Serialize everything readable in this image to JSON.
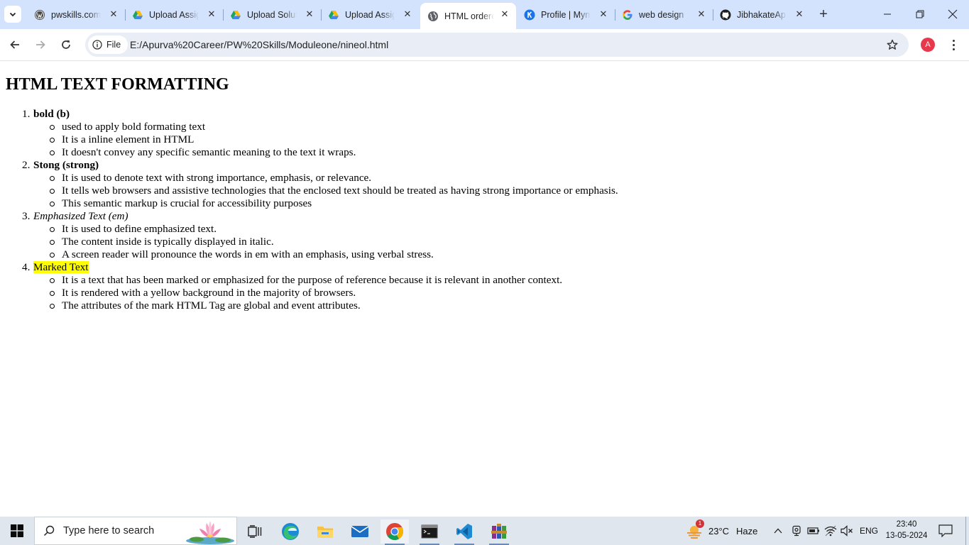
{
  "browser": {
    "tabs": [
      {
        "title": "pwskills.com",
        "icon": "wordpress-icon",
        "active": false
      },
      {
        "title": "Upload Assig",
        "icon": "google-drive-icon",
        "active": false
      },
      {
        "title": "Upload Solut",
        "icon": "google-drive-icon",
        "active": false
      },
      {
        "title": "Upload Assig",
        "icon": "google-drive-icon",
        "active": false
      },
      {
        "title": "HTML ordere",
        "icon": "globe-icon",
        "active": true
      },
      {
        "title": "Profile | Myn",
        "icon": "profile-icon",
        "active": false
      },
      {
        "title": "web design",
        "icon": "google-icon",
        "active": false
      },
      {
        "title": "JibhakateAp",
        "icon": "github-icon",
        "active": false
      }
    ],
    "new_tab_label": "+",
    "omnibox": {
      "chip_label": "File",
      "url": "E:/Apurva%20Career/PW%20Skills/Moduleone/nineol.html"
    },
    "avatar_letter": "A"
  },
  "page": {
    "heading": "HTML TEXT FORMATTING",
    "sections": [
      {
        "number": "1.",
        "title": "bold (b)",
        "style": "bold",
        "points": [
          "used to apply bold formating text",
          "It is a inline element in HTML",
          "It doesn't convey any specific semantic meaning to the text it wraps."
        ]
      },
      {
        "number": "2.",
        "title": "Stong (strong)",
        "style": "bold",
        "points": [
          "It is used to denote text with strong importance, emphasis, or relevance.",
          "It tells web browsers and assistive technologies that the enclosed text should be treated as having strong importance or emphasis.",
          "This semantic markup is crucial for accessibility purposes"
        ]
      },
      {
        "number": "3.",
        "title": "Emphasized Text (em)",
        "style": "italic",
        "points": [
          "It is used to define emphasized text.",
          "The content inside is typically displayed in italic.",
          "A screen reader will pronounce the words in em with an emphasis, using verbal stress."
        ]
      },
      {
        "number": "4.",
        "title": "Marked Text",
        "style": "mark",
        "points": [
          "It is a text that has been marked or emphasized for the purpose of reference because it is relevant in another context.",
          "It is rendered with a yellow background in the majority of browsers.",
          "The attributes of the mark HTML Tag are global and event attributes."
        ]
      }
    ],
    "mark_color": "#ffff00"
  },
  "taskbar": {
    "search_placeholder": "Type here to search",
    "weather": {
      "temp": "23°C",
      "condition": "Haze",
      "badge": "1"
    },
    "language": "ENG",
    "time": "23:40",
    "date": "13-05-2024",
    "accent": "#0078d4"
  }
}
